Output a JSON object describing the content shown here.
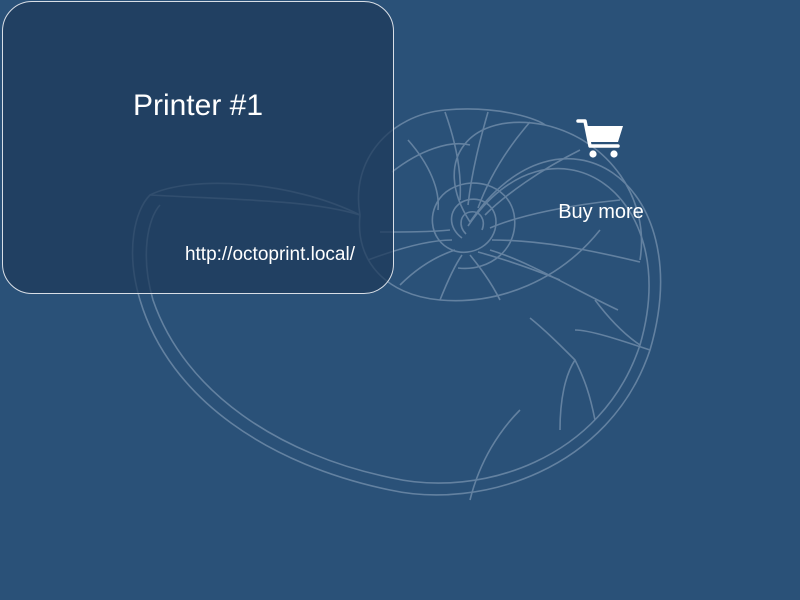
{
  "printers": [
    {
      "name": "Printer #1",
      "url": "http://octoprint.local/"
    }
  ],
  "shop": {
    "label": "Buy more",
    "icon": "shopping-cart-icon"
  },
  "colors": {
    "background": "#2a5178",
    "card": "#1f3a5a",
    "card_border": "#d8dee6",
    "text": "#ffffff"
  },
  "background_logo": "nautilus-shell-icon"
}
